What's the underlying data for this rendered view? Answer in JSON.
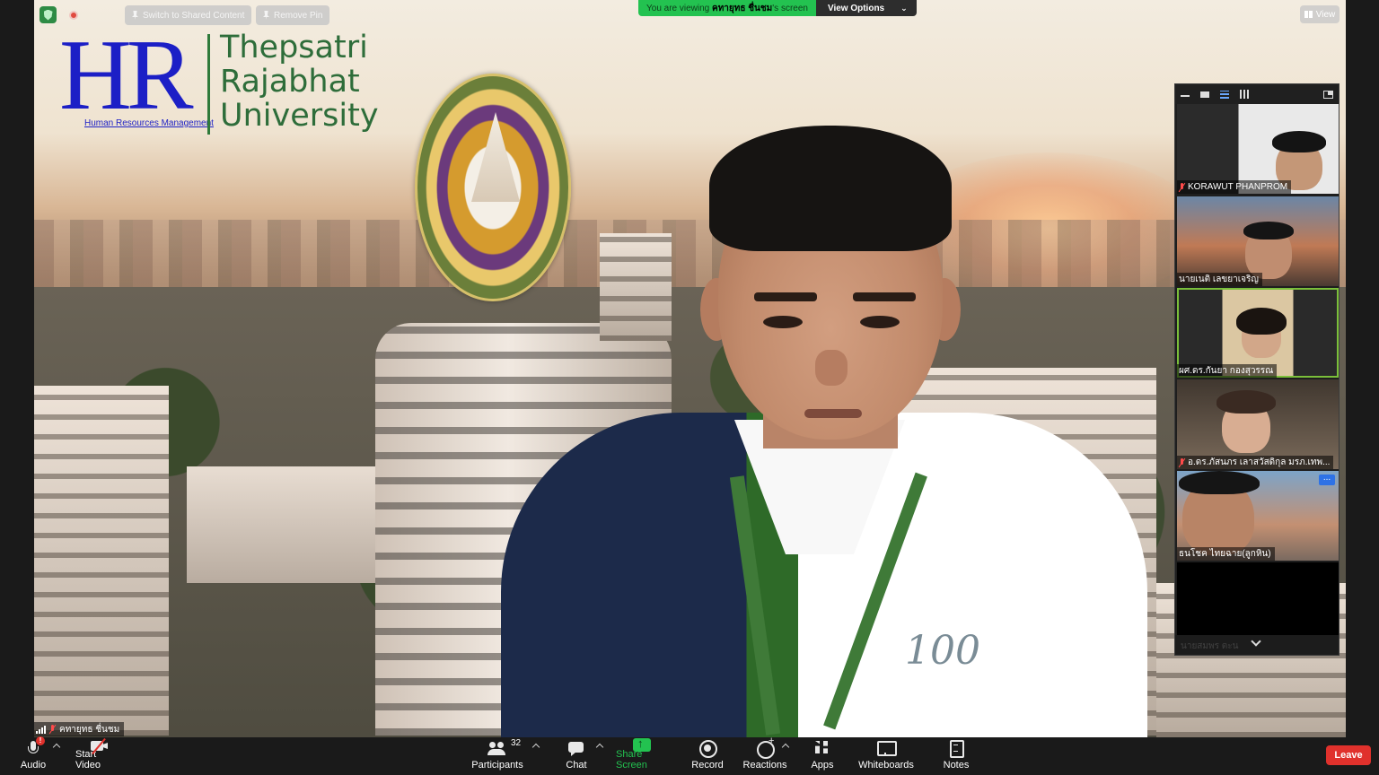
{
  "banner": {
    "viewing_prefix": "You are viewing",
    "viewing_name": "คทายุทธ ชื่นชม",
    "viewing_suffix": "'s screen",
    "view_options": "View Options"
  },
  "top_left": {
    "switch_shared": "Switch to Shared Content",
    "remove_pin": "Remove Pin"
  },
  "top_right": {
    "view": "View"
  },
  "shared_content": {
    "logo_letters": "HR",
    "logo_sub": "Human Resources Management",
    "university_lines": [
      "Thepsatri",
      "Rajabhat",
      "University"
    ]
  },
  "stage_name": "คทายุทธ ชื่นชม",
  "gallery": {
    "tiles": [
      {
        "name": "KORAWUT PHANPROM",
        "muted": true
      },
      {
        "name": "นายเนติ เลขยาเจริญ",
        "muted": false
      },
      {
        "name": "ผศ.ดร.กันยา กองสุวรรณ",
        "muted": false
      },
      {
        "name": "อ.ดร.ภัสนภร เลาสวัสดิกุล มรภ.เทพ...",
        "muted": true
      },
      {
        "name": "ธนโชค ไทยฉาย(ลูกหิน)",
        "muted": false
      },
      {
        "name": "",
        "muted": false
      }
    ],
    "more_name": "นายสมพร ตะน"
  },
  "toolbar": {
    "audio": "Audio",
    "audio_badge": "!",
    "start_video": "Start Video",
    "participants": "Participants",
    "participant_count": "32",
    "chat": "Chat",
    "share_screen": "Share Screen",
    "record": "Record",
    "reactions": "Reactions",
    "apps": "Apps",
    "whiteboards": "Whiteboards",
    "notes": "Notes",
    "leave": "Leave"
  },
  "colors": {
    "share_green": "#23c250",
    "leave_red": "#e0312c",
    "active_speaker": "#7bbf3a",
    "hr_blue": "#1c1fc6",
    "uni_green": "#2e6d3a"
  }
}
